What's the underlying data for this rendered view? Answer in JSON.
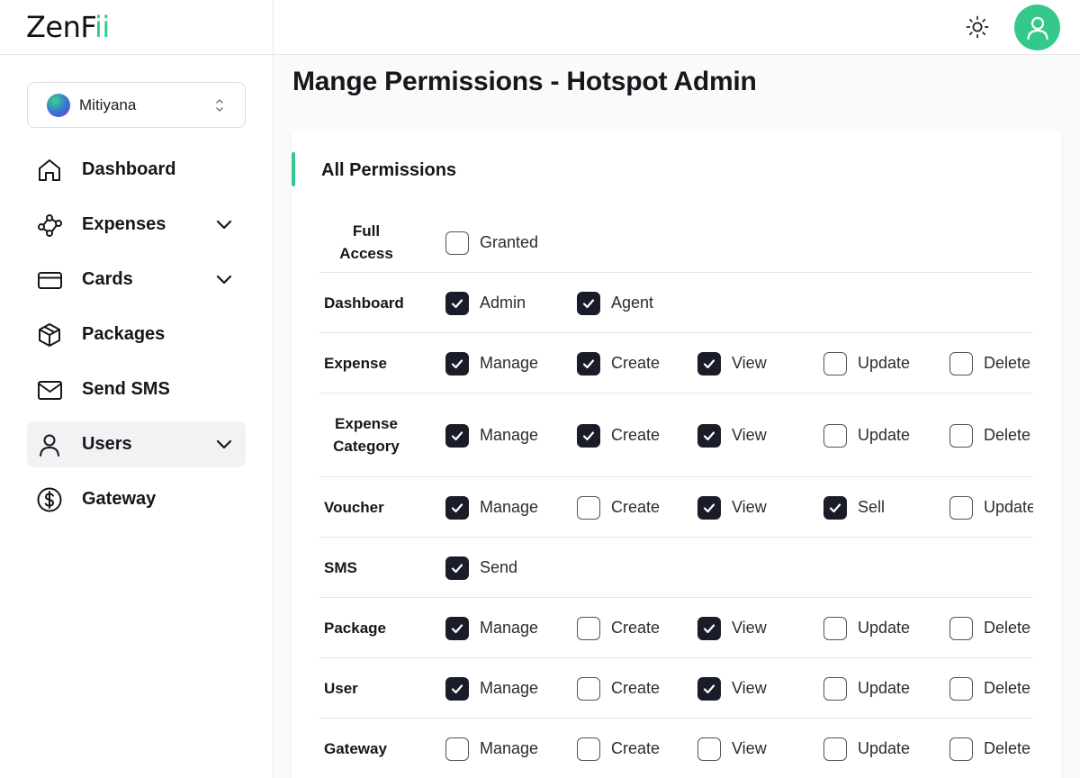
{
  "app": {
    "logo_main": "ZenF",
    "logo_accent": "ii"
  },
  "org_select": {
    "value": "Mitiyana"
  },
  "sidebar": {
    "items": [
      {
        "label": "Dashboard",
        "icon": "home-icon",
        "has_chevron": false,
        "active": false
      },
      {
        "label": "Expenses",
        "icon": "nodes-icon",
        "has_chevron": true,
        "active": false
      },
      {
        "label": "Cards",
        "icon": "credit-card-icon",
        "has_chevron": true,
        "active": false
      },
      {
        "label": "Packages",
        "icon": "package-icon",
        "has_chevron": false,
        "active": false
      },
      {
        "label": "Send SMS",
        "icon": "mail-icon",
        "has_chevron": false,
        "active": false
      },
      {
        "label": "Users",
        "icon": "user-icon",
        "has_chevron": true,
        "active": true
      },
      {
        "label": "Gateway",
        "icon": "dollar-circle-icon",
        "has_chevron": false,
        "active": false
      }
    ]
  },
  "header": {
    "theme_icon": "sun-icon",
    "avatar_icon": "user-icon",
    "accent_color": "#34c98b"
  },
  "main": {
    "title": "Mange Permissions - Hotspot Admin",
    "card_title": "All Permissions"
  },
  "permissions": [
    {
      "name_lines": [
        "Full",
        "Access"
      ],
      "options": [
        {
          "label": "Granted",
          "checked": false
        }
      ]
    },
    {
      "name_lines": [
        "Dashboard"
      ],
      "options": [
        {
          "label": "Admin",
          "checked": true
        },
        {
          "label": "Agent",
          "checked": true
        }
      ]
    },
    {
      "name_lines": [
        "Expense"
      ],
      "options": [
        {
          "label": "Manage",
          "checked": true
        },
        {
          "label": "Create",
          "checked": true
        },
        {
          "label": "View",
          "checked": true
        },
        {
          "label": "Update",
          "checked": false
        },
        {
          "label": "Delete",
          "checked": false
        }
      ]
    },
    {
      "name_lines": [
        "Expense",
        "Category"
      ],
      "options": [
        {
          "label": "Manage",
          "checked": true
        },
        {
          "label": "Create",
          "checked": true
        },
        {
          "label": "View",
          "checked": true
        },
        {
          "label": "Update",
          "checked": false
        },
        {
          "label": "Delete",
          "checked": false
        }
      ]
    },
    {
      "name_lines": [
        "Voucher"
      ],
      "options": [
        {
          "label": "Manage",
          "checked": true
        },
        {
          "label": "Create",
          "checked": false
        },
        {
          "label": "View",
          "checked": true
        },
        {
          "label": "Sell",
          "checked": true
        },
        {
          "label": "Update",
          "checked": false
        }
      ]
    },
    {
      "name_lines": [
        "SMS"
      ],
      "options": [
        {
          "label": "Send",
          "checked": true
        }
      ]
    },
    {
      "name_lines": [
        "Package"
      ],
      "options": [
        {
          "label": "Manage",
          "checked": true
        },
        {
          "label": "Create",
          "checked": false
        },
        {
          "label": "View",
          "checked": true
        },
        {
          "label": "Update",
          "checked": false
        },
        {
          "label": "Delete",
          "checked": false
        }
      ]
    },
    {
      "name_lines": [
        "User"
      ],
      "options": [
        {
          "label": "Manage",
          "checked": true
        },
        {
          "label": "Create",
          "checked": false
        },
        {
          "label": "View",
          "checked": true
        },
        {
          "label": "Update",
          "checked": false
        },
        {
          "label": "Delete",
          "checked": false
        }
      ]
    },
    {
      "name_lines": [
        "Gateway"
      ],
      "options": [
        {
          "label": "Manage",
          "checked": false
        },
        {
          "label": "Create",
          "checked": false
        },
        {
          "label": "View",
          "checked": false
        },
        {
          "label": "Update",
          "checked": false
        },
        {
          "label": "Delete",
          "checked": false
        }
      ]
    }
  ]
}
